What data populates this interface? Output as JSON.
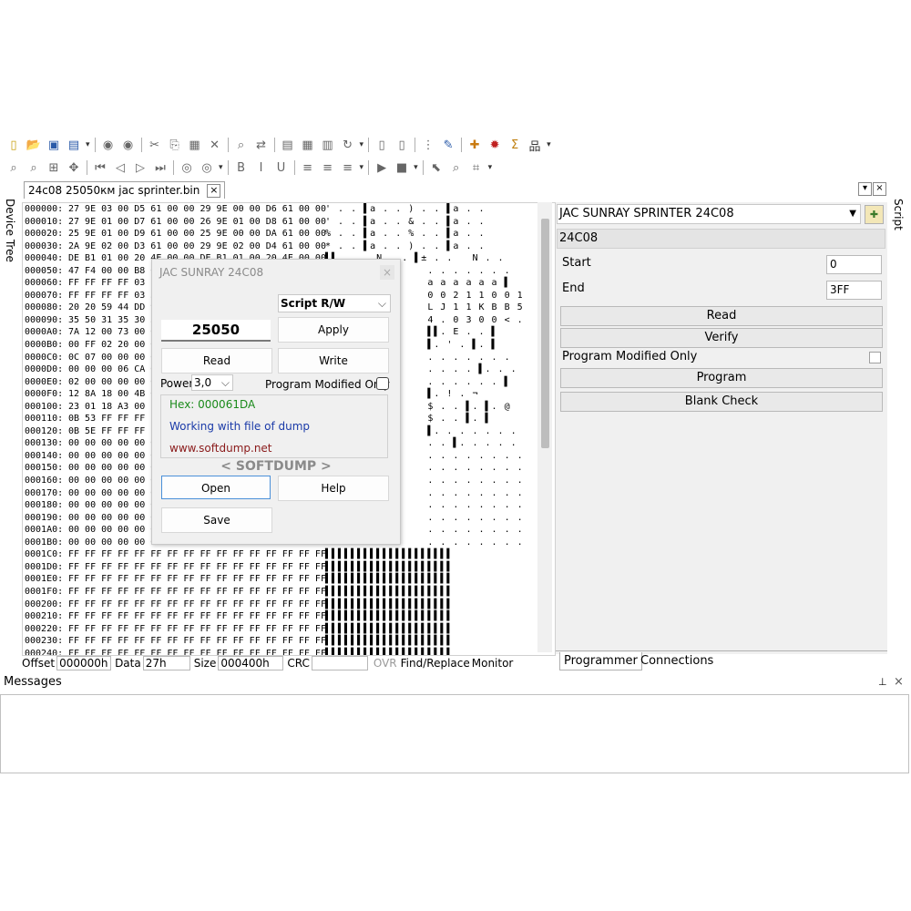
{
  "toolbar": {
    "row1_icons": [
      "new-file-icon",
      "open-folder-icon",
      "save-icon",
      "save-as-icon",
      "prev-circle-icon",
      "next-circle-icon",
      "cut-icon",
      "copy-icon",
      "paste-icon",
      "delete-icon",
      "find-icon",
      "replace-icon",
      "document-icon",
      "table-icon",
      "grid-icon",
      "refresh-icon",
      "page-icon",
      "page2-icon",
      "dots-icon",
      "edit-icon",
      "plugin-icon",
      "bug-icon",
      "sigma-icon",
      "network-icon"
    ],
    "row2_icons": [
      "zoom-in-icon",
      "zoom-out-icon",
      "fit-icon",
      "move-icon",
      "first-icon",
      "prev-icon",
      "next-icon",
      "last-icon",
      "nav-left-icon",
      "nav-right-icon",
      "bold-icon",
      "italic-icon",
      "underline-icon",
      "align-left-icon",
      "align-center-icon",
      "align-right-icon",
      "play-icon",
      "stop-icon",
      "pointer-icon",
      "zoom-select-icon",
      "crop-icon"
    ]
  },
  "tabs": {
    "file_tab": "24c08  25050км jac sprinter.bin",
    "close_symbol": "×",
    "left_side_tab": "Device Tree",
    "right_side_tab": "Script"
  },
  "hex": {
    "rows": [
      {
        "off": "000000:",
        "bytes": "27 9E 03 00 D5 61 00 00 29 9E 00 00 D6 61 00 00",
        "ascii": "' . . ▌a . . ) . . ▌a . ."
      },
      {
        "off": "000010:",
        "bytes": "27 9E 01 00 D7 61 00 00 26 9E 01 00 D8 61 00 00",
        "ascii": "' . . ▌a . . & . . ▌a . ."
      },
      {
        "off": "000020:",
        "bytes": "25 9E 01 00 D9 61 00 00 25 9E 00 00 DA 61 00 00",
        "ascii": "% . . ▌a . . % . . ▌a . ."
      },
      {
        "off": "000030:",
        "bytes": "2A 9E 02 00 D3 61 00 00 29 9E 02 00 D4 61 00 00",
        "ascii": "* . . ▌a . . ) . . ▌a . ."
      },
      {
        "off": "000040:",
        "bytes": "DE B1 01 00 20 4E 00 00 DE B1 01 00 20 4E 00 00",
        "ascii": "▌▌. .   N . . ▌± . .   N . ."
      },
      {
        "off": "000050:",
        "bytes": "47 F4 00 00 B8 0",
        "ascii": "                . . . . . . ."
      },
      {
        "off": "000060:",
        "bytes": "FF FF FF FF 03 1",
        "ascii": "                a a a a a a ▌"
      },
      {
        "off": "000070:",
        "bytes": "FF FF FF FF 03 30 3",
        "ascii": "                0 0 2 1 1 0 0 1"
      },
      {
        "off": "000080:",
        "bytes": "20 20 59 44 DD 9",
        "ascii": "                L J 1 1 K B B 5"
      },
      {
        "off": "000090:",
        "bytes": "35 50 31 35 30 3",
        "ascii": "                4 . 0 3 0 0 < ."
      },
      {
        "off": "0000A0:",
        "bytes": "7A 12 00 73 00 0",
        "ascii": "                ▌▌. E . . ▌"
      },
      {
        "off": "0000B0:",
        "bytes": "00 FF 02 20 00 0",
        "ascii": "                ▌. ' . ▌. ▌"
      },
      {
        "off": "0000C0:",
        "bytes": "0C 07 00 00 00 0",
        "ascii": "                . . . . . . ."
      },
      {
        "off": "0000D0:",
        "bytes": "00 00 00 06 CA 0",
        "ascii": "                . . . . ▌. . ."
      },
      {
        "off": "0000E0:",
        "bytes": "02 00 00 00 00 0",
        "ascii": "                . . . . . . ▌"
      },
      {
        "off": "0000F0:",
        "bytes": "12 8A 18 00 4B 0",
        "ascii": "                ▌. ! . ¬"
      },
      {
        "off": "000100:",
        "bytes": "23 01 18 A3 00 F",
        "ascii": "                $ . . ▌. ▌. @"
      },
      {
        "off": "000110:",
        "bytes": "0B 53 FF FF FF F",
        "ascii": "                $ . . ▌. ▌"
      },
      {
        "off": "000120:",
        "bytes": "0B 5E FF FF FF F",
        "ascii": "                ▌. . . . . . ."
      },
      {
        "off": "000130:",
        "bytes": "00 00 00 00 00 0",
        "ascii": "                . . ▌. . . . ."
      },
      {
        "off": "000140:",
        "bytes": "00 00 00 00 00 0",
        "ascii": "                . . . . . . . ."
      },
      {
        "off": "000150:",
        "bytes": "00 00 00 00 00 0",
        "ascii": "                . . . . . . . ."
      },
      {
        "off": "000160:",
        "bytes": "00 00 00 00 00 0",
        "ascii": "                . . . . . . . ."
      },
      {
        "off": "000170:",
        "bytes": "00 00 00 00 00 0",
        "ascii": "                . . . . . . . ."
      },
      {
        "off": "000180:",
        "bytes": "00 00 00 00 00 0",
        "ascii": "                . . . . . . . ."
      },
      {
        "off": "000190:",
        "bytes": "00 00 00 00 00 0",
        "ascii": "                . . . . . . . ."
      },
      {
        "off": "0001A0:",
        "bytes": "00 00 00 00 00 0",
        "ascii": "                . . . . . . . ."
      },
      {
        "off": "0001B0:",
        "bytes": "00 00 00 00 00 0",
        "ascii": "                . . . . . . . ."
      },
      {
        "off": "0001C0:",
        "bytes": "FF FF FF FF FF FF FF FF FF FF FF FF FF FF FF FF",
        "ascii": "▌▌▌▌▌▌▌▌▌▌▌▌▌▌▌▌▌▌▌▌"
      },
      {
        "off": "0001D0:",
        "bytes": "FF FF FF FF FF FF FF FF FF FF FF FF FF FF FF FF",
        "ascii": "▌▌▌▌▌▌▌▌▌▌▌▌▌▌▌▌▌▌▌▌"
      },
      {
        "off": "0001E0:",
        "bytes": "FF FF FF FF FF FF FF FF FF FF FF FF FF FF FF FF",
        "ascii": "▌▌▌▌▌▌▌▌▌▌▌▌▌▌▌▌▌▌▌▌"
      },
      {
        "off": "0001F0:",
        "bytes": "FF FF FF FF FF FF FF FF FF FF FF FF FF FF FF FF",
        "ascii": "▌▌▌▌▌▌▌▌▌▌▌▌▌▌▌▌▌▌▌▌"
      },
      {
        "off": "000200:",
        "bytes": "FF FF FF FF FF FF FF FF FF FF FF FF FF FF FF FF",
        "ascii": "▌▌▌▌▌▌▌▌▌▌▌▌▌▌▌▌▌▌▌▌"
      },
      {
        "off": "000210:",
        "bytes": "FF FF FF FF FF FF FF FF FF FF FF FF FF FF FF FF",
        "ascii": "▌▌▌▌▌▌▌▌▌▌▌▌▌▌▌▌▌▌▌▌"
      },
      {
        "off": "000220:",
        "bytes": "FF FF FF FF FF FF FF FF FF FF FF FF FF FF FF FF",
        "ascii": "▌▌▌▌▌▌▌▌▌▌▌▌▌▌▌▌▌▌▌▌"
      },
      {
        "off": "000230:",
        "bytes": "FF FF FF FF FF FF FF FF FF FF FF FF FF FF FF FF",
        "ascii": "▌▌▌▌▌▌▌▌▌▌▌▌▌▌▌▌▌▌▌▌"
      },
      {
        "off": "000240:",
        "bytes": "FF FF FF FF FF FF FF FF FF FF FF FF FF FF FF FF",
        "ascii": "▌▌▌▌▌▌▌▌▌▌▌▌▌▌▌▌▌▌▌▌"
      }
    ]
  },
  "status": {
    "offset_label": "Offset",
    "offset_value": "000000h",
    "data_label": "Data",
    "data_value": "27h",
    "size_label": "Size",
    "size_value": "000400h",
    "crc_label": "CRC",
    "crc_value": "",
    "ovr": "OVR",
    "find_replace": "Find/Replace",
    "monitor": "Monitor"
  },
  "dialog": {
    "title": "JAC SUNRAY 24C08",
    "close": "×",
    "script_select": "Script R/W",
    "number": "25050",
    "apply": "Apply",
    "read": "Read",
    "write": "Write",
    "power_label": "Power",
    "power_value": "3,0",
    "program_modified_only": "Program Modified Only",
    "info_hex": "Hex: 000061DA",
    "info_working": "Working with file of dump",
    "info_url": "www.softdump.net",
    "brand": "< SOFTDUMP >",
    "open": "Open",
    "help": "Help",
    "save": "Save",
    "colors": {
      "hex": "#1a8a1a",
      "working": "#1a3aa8",
      "url": "#8a1a1a",
      "brand": "#8a8a8a"
    }
  },
  "right_panel": {
    "device_select": "JAC SUNRAY SPRINTER 24C08",
    "chip": "24C08",
    "start_label": "Start",
    "start_value": "0",
    "end_label": "End",
    "end_value": "3FF",
    "read": "Read",
    "verify": "Verify",
    "program_modified_only": "Program Modified Only",
    "program": "Program",
    "blank_check": "Blank Check",
    "tab_programmer": "Programmer",
    "tab_connections": "Connections"
  },
  "messages": {
    "title": "Messages",
    "pin": "⊥",
    "close": "×"
  }
}
